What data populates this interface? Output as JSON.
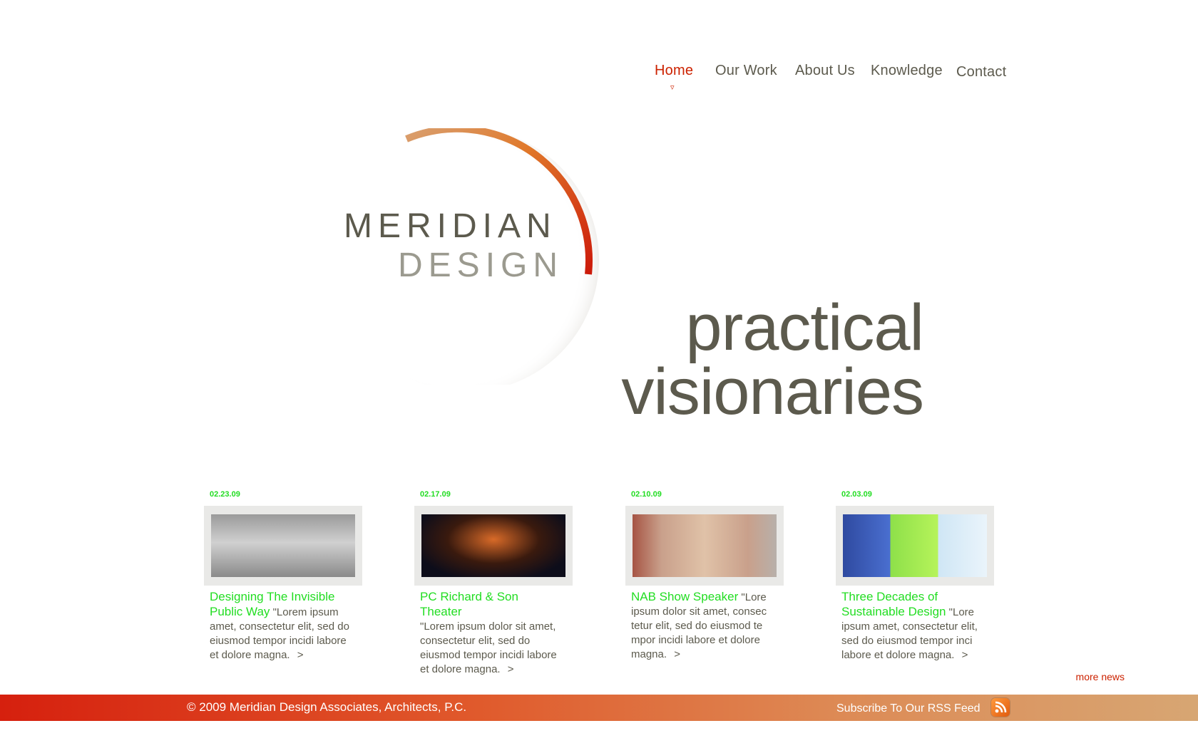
{
  "nav": {
    "items": [
      {
        "label": "Home",
        "active": true
      },
      {
        "label": "Our Work"
      },
      {
        "label": "About Us"
      },
      {
        "label": "Knowledge"
      },
      {
        "label": "Contact"
      }
    ],
    "indicator": "▿"
  },
  "logo": {
    "line1": "MERIDIAN",
    "line2": "DESIGN"
  },
  "tagline": {
    "line1": "practical",
    "line2": "visionaries"
  },
  "news": [
    {
      "date": "02.23.09",
      "title": "Designing The Invisible Public Way",
      "excerpt": "\"Lorem ipsum amet, consectetur elit, sed do eiusmod tempor incidi labore et dolore magna.",
      "more": ">"
    },
    {
      "date": "02.17.09",
      "title": "PC Richard & Son Theater",
      "excerpt": "\"Lorem ipsum dolor sit amet, consectetur elit, sed do eiusmod tempor incidi labore et dolore magna.",
      "more": ">"
    },
    {
      "date": "02.10.09",
      "title": "NAB Show Speaker",
      "excerpt": "\"Lore ipsum dolor sit amet, consec tetur elit, sed do eiusmod te mpor incidi labore et dolore magna.",
      "more": ">"
    },
    {
      "date": "02.03.09",
      "title": "Three Decades of Sustainable Design",
      "excerpt": "\"Lore ipsum amet, consectetur elit, sed do eiusmod tempor inci labore et dolore magna.",
      "more": ">"
    }
  ],
  "more_news": "more news",
  "footer": {
    "copyright": "© 2009 Meridian Design Associates, Architects, P.C.",
    "rss_label": "Subscribe To Our RSS Feed"
  },
  "colors": {
    "accent_red": "#cc2200",
    "news_green": "#22dd22",
    "text_olive": "#5c5a4d"
  }
}
